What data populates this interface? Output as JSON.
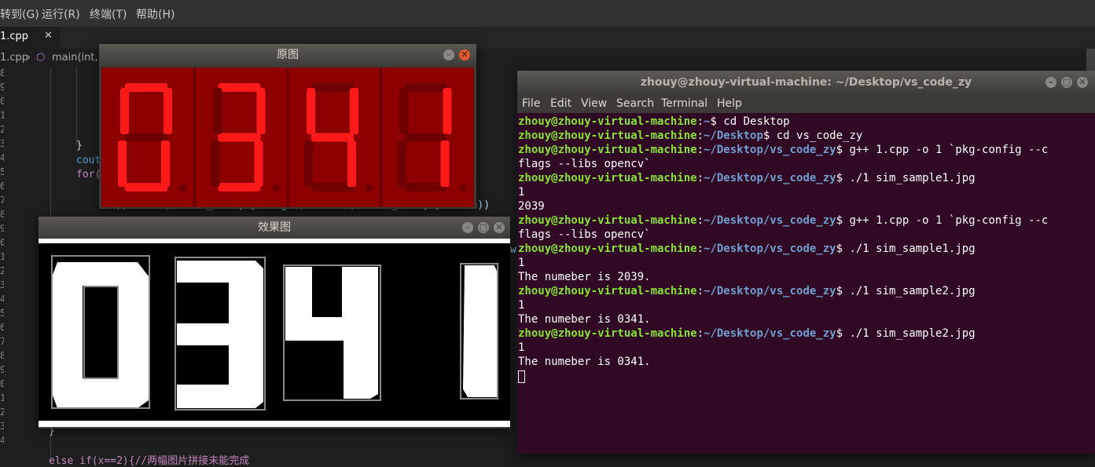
{
  "editor": {
    "menu": [
      "转到(G)",
      "运行(R)",
      "终端(T)",
      "帮助(H)"
    ],
    "tab": {
      "name": "1.cpp",
      "close": "✕"
    },
    "breadcrumb": {
      "file": "1.cpp",
      "symbol": "main(int, c"
    },
    "code_lines": {
      "l1": "}",
      "l2": "cout",
      "l3": "for(",
      "l4": "if((double(border_rect[i].height)/double(border_rect[i].width))",
      "l5": "w",
      "l6": "}",
      "l7": "else if(x==2){//两幅图片拼接未能完成"
    }
  },
  "windows": {
    "original": {
      "title": "原图",
      "digits_shown": "0341",
      "segment_on_color": "#ff1a1a",
      "segment_off_color": "#6e0000",
      "panel_color": "#8c0000"
    },
    "effect": {
      "title": "效果图",
      "digits_shown": "0341"
    },
    "terminal": {
      "title": "zhouy@zhouy-virtual-machine: ~/Desktop/vs_code_zy",
      "menu": [
        "File",
        "Edit",
        "View",
        "Search",
        "Terminal",
        "Help"
      ],
      "prompt_user": "zhouy@zhouy-virtual-machine",
      "path_home": "~",
      "path_desktop": "~/Desktop",
      "path_project": "~/Desktop/vs_code_zy",
      "commands": {
        "c1": "cd Desktop",
        "c2": "cd vs_code_zy",
        "c3": "g++ 1.cpp -o 1 `pkg-config --c",
        "c3b": "flags --libs opencv`",
        "c4": "./1 sim_sample1.jpg",
        "c5": "g++ 1.cpp -o 1 `pkg-config --c",
        "c5b": "flags --libs opencv`",
        "c6": "./1 sim_sample1.jpg",
        "c7": "./1 sim_sample2.jpg",
        "c8": "./1 sim_sample2.jpg"
      },
      "outputs": {
        "o1": "1",
        "o2": "2039",
        "o3": "1",
        "o4": "The numeber is 2039.",
        "o5": "1",
        "o6": "The numeber is 0341.",
        "o7": "1",
        "o8": "The numeber is 0341."
      }
    }
  }
}
